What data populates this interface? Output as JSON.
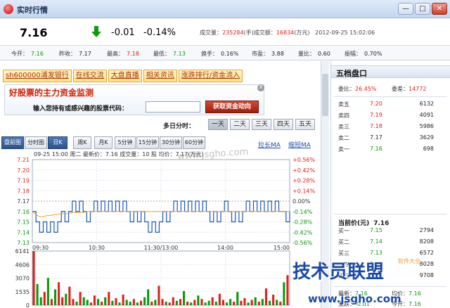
{
  "window": {
    "title": "实时行情",
    "min_label": "—",
    "max_label": "□",
    "close_label": "✕"
  },
  "quote": {
    "price": "7.16",
    "change": "-0.01",
    "change_pct": "-0.14%",
    "vol_label": "成交量：",
    "vol_value": "235284",
    "vol_unit": "(手)",
    "amt_label": "成交额：",
    "amt_value": "16834",
    "amt_unit": "(万元)",
    "datetime": "2012-09-25 15:02:06"
  },
  "stats": [
    {
      "label": "今开：",
      "value": "7.16",
      "color": "grn"
    },
    {
      "label": "昨收：",
      "value": "7.17",
      "color": "blk"
    },
    {
      "label": "最高：",
      "value": "7.18",
      "color": "red"
    },
    {
      "label": "最低：",
      "value": "7.13",
      "color": "grn"
    },
    {
      "label": "换手：",
      "value": "0.16%",
      "color": "blk"
    },
    {
      "label": "市盈：",
      "value": "3.88",
      "color": "blk"
    },
    {
      "label": "量比：",
      "value": "0.60",
      "color": "blk"
    },
    {
      "label": "振幅：",
      "value": "0.70%",
      "color": "blk"
    }
  ],
  "links": [
    "sh600000浦发银行",
    "在线交流",
    "大盘直播",
    "相关资讯",
    "涨跌排行/资金流入"
  ],
  "monitor": {
    "title": "好股票的主力资金监测",
    "label": "输入您持有或感兴趣的股票代码：",
    "button": "获取资金动向",
    "close": "x"
  },
  "multi_day": {
    "label": "多日分时：",
    "buttons": [
      "一天",
      "二天",
      "三天",
      "四天",
      "五天"
    ]
  },
  "period_tabs": [
    "盘前图",
    "分时图",
    "日K",
    "周K",
    "月K",
    "5分钟",
    "15分钟",
    "30分钟",
    "60分钟"
  ],
  "zoom": {
    "stretch": "拉长MA",
    "shrink": "缩短MA"
  },
  "chart_data": {
    "type": "line",
    "info_line": "09-25 15:00  周二  最新价：7.16  成交量：10 股  均价：7.17(万元)",
    "price_ticks": [
      "7.21",
      "7.20",
      "7.19",
      "7.18",
      "7.17",
      "7.16",
      "7.15",
      "7.14",
      "7.13"
    ],
    "pct_ticks": [
      "+0.56%",
      "+0.42%",
      "+0.28%",
      "+0.14%",
      "0.00%",
      "-0.14%",
      "-0.28%",
      "-0.42%",
      "-0.56%"
    ],
    "x_ticks": [
      "09:30",
      "10:30",
      "11:30/13:00",
      "14:00",
      "15:00"
    ],
    "ylim": [
      7.13,
      7.21
    ],
    "prev_close": 7.17,
    "series": [
      {
        "values": [
          7.16,
          7.15,
          7.14,
          7.15,
          7.14,
          7.15,
          7.14,
          7.15,
          7.16,
          7.15,
          7.16,
          7.17,
          7.16,
          7.17,
          7.16,
          7.15,
          7.16,
          7.17,
          7.16,
          7.17,
          7.16,
          7.17,
          7.16,
          7.17,
          7.16,
          7.17,
          7.16,
          7.15,
          7.16,
          7.15,
          7.16,
          7.15,
          7.14,
          7.15,
          7.14,
          7.15,
          7.16,
          7.15,
          7.16,
          7.17,
          7.16,
          7.17,
          7.16,
          7.17,
          7.16,
          7.17,
          7.16,
          7.17,
          7.16,
          7.15,
          7.16,
          7.15,
          7.16,
          7.17,
          7.16,
          7.15,
          7.16,
          7.15,
          7.16,
          7.17,
          7.16,
          7.17,
          7.16,
          7.17,
          7.16,
          7.17,
          7.16,
          7.17,
          7.16,
          7.16,
          7.15,
          7.16
        ]
      },
      {
        "values": [
          7.16,
          7.157,
          7.155,
          7.155,
          7.156,
          7.156,
          7.157,
          7.157,
          7.158,
          7.158,
          7.158,
          7.159,
          7.159,
          7.159,
          7.159,
          7.16,
          7.16,
          7.16,
          7.16,
          7.16,
          7.16,
          7.16,
          7.16,
          7.16,
          7.16,
          7.16,
          7.16,
          7.16,
          7.16,
          7.16,
          7.16,
          7.16,
          7.16,
          7.16,
          7.16,
          7.16,
          7.16,
          7.16,
          7.16,
          7.16,
          7.16,
          7.16,
          7.16,
          7.16,
          7.16,
          7.16,
          7.16,
          7.16,
          7.16,
          7.16,
          7.16,
          7.16,
          7.16,
          7.16,
          7.16,
          7.16,
          7.16,
          7.16,
          7.16,
          7.16,
          7.16,
          7.16,
          7.16,
          7.16,
          7.16,
          7.16,
          7.16,
          7.16,
          7.16,
          7.16,
          7.16,
          7.16
        ]
      }
    ],
    "volume_ticks": [
      "6141",
      "4606",
      "3070",
      "1535",
      "0"
    ],
    "volume_ylim": [
      0,
      6141
    ],
    "volume": [
      6141,
      2400,
      900,
      1500,
      3100,
      700,
      1800,
      2600,
      900,
      1300,
      2100,
      700,
      400,
      1500,
      900,
      600,
      300,
      1100,
      700,
      400,
      900,
      1500,
      500,
      800,
      300,
      1200,
      600,
      400,
      700,
      300,
      500,
      900,
      1800,
      400,
      600,
      2200,
      700,
      400,
      300,
      900,
      500,
      700,
      1600,
      400,
      300,
      600,
      1100,
      700,
      300,
      500,
      900,
      400,
      1300,
      600,
      300,
      700,
      400,
      1500,
      500,
      800,
      300,
      600,
      900,
      400,
      700,
      1900,
      500,
      1200,
      600,
      400,
      2600,
      3400
    ]
  },
  "order_book": {
    "title": "五档盘口",
    "ratio_label": "委比：",
    "ratio_value": "26.45%",
    "diff_label": "委差：",
    "diff_value": "14772",
    "sells": [
      {
        "label": "卖五",
        "price": "7.20",
        "qty": "6132"
      },
      {
        "label": "卖四",
        "price": "7.19",
        "qty": "4091"
      },
      {
        "label": "卖三",
        "price": "7.18",
        "qty": "5986"
      },
      {
        "label": "卖二",
        "price": "7.17",
        "qty": "3629"
      },
      {
        "label": "卖一",
        "price": "7.16",
        "qty": "698"
      }
    ],
    "current_label": "当前价(元)",
    "current_value": "7.16",
    "buys": [
      {
        "label": "买一",
        "price": "7.15",
        "qty": "2794"
      },
      {
        "label": "买二",
        "price": "7.14",
        "qty": "8208"
      },
      {
        "label": "买三",
        "price": "7.13",
        "qty": "6572"
      },
      {
        "label": "买四",
        "price": "7.12",
        "qty": "8028"
      },
      {
        "label": "买五",
        "price": "7.11",
        "qty": "9708"
      }
    ],
    "summary": [
      {
        "a_label": "最新：",
        "a_value": "7.16",
        "b_label": "均价：",
        "b_value": "7.16"
      },
      {
        "a_label": "涨跌：",
        "a_value": "-0.01",
        "b_label": "今开：",
        "b_value": "7.16"
      },
      {
        "a_label": "涨幅：",
        "a_value": "-0.14%",
        "b_label": "最高：",
        "b_value": "7.18"
      }
    ]
  },
  "colors": {
    "up": "#e0201a",
    "down": "#0a9a0a",
    "line": "#1a56b8",
    "avg": "#f0a020"
  },
  "watermarks": {
    "logo": "技术员联盟",
    "url": "www.jsgho.com",
    "center": "www.jsgho.com",
    "small": "软件大全"
  }
}
